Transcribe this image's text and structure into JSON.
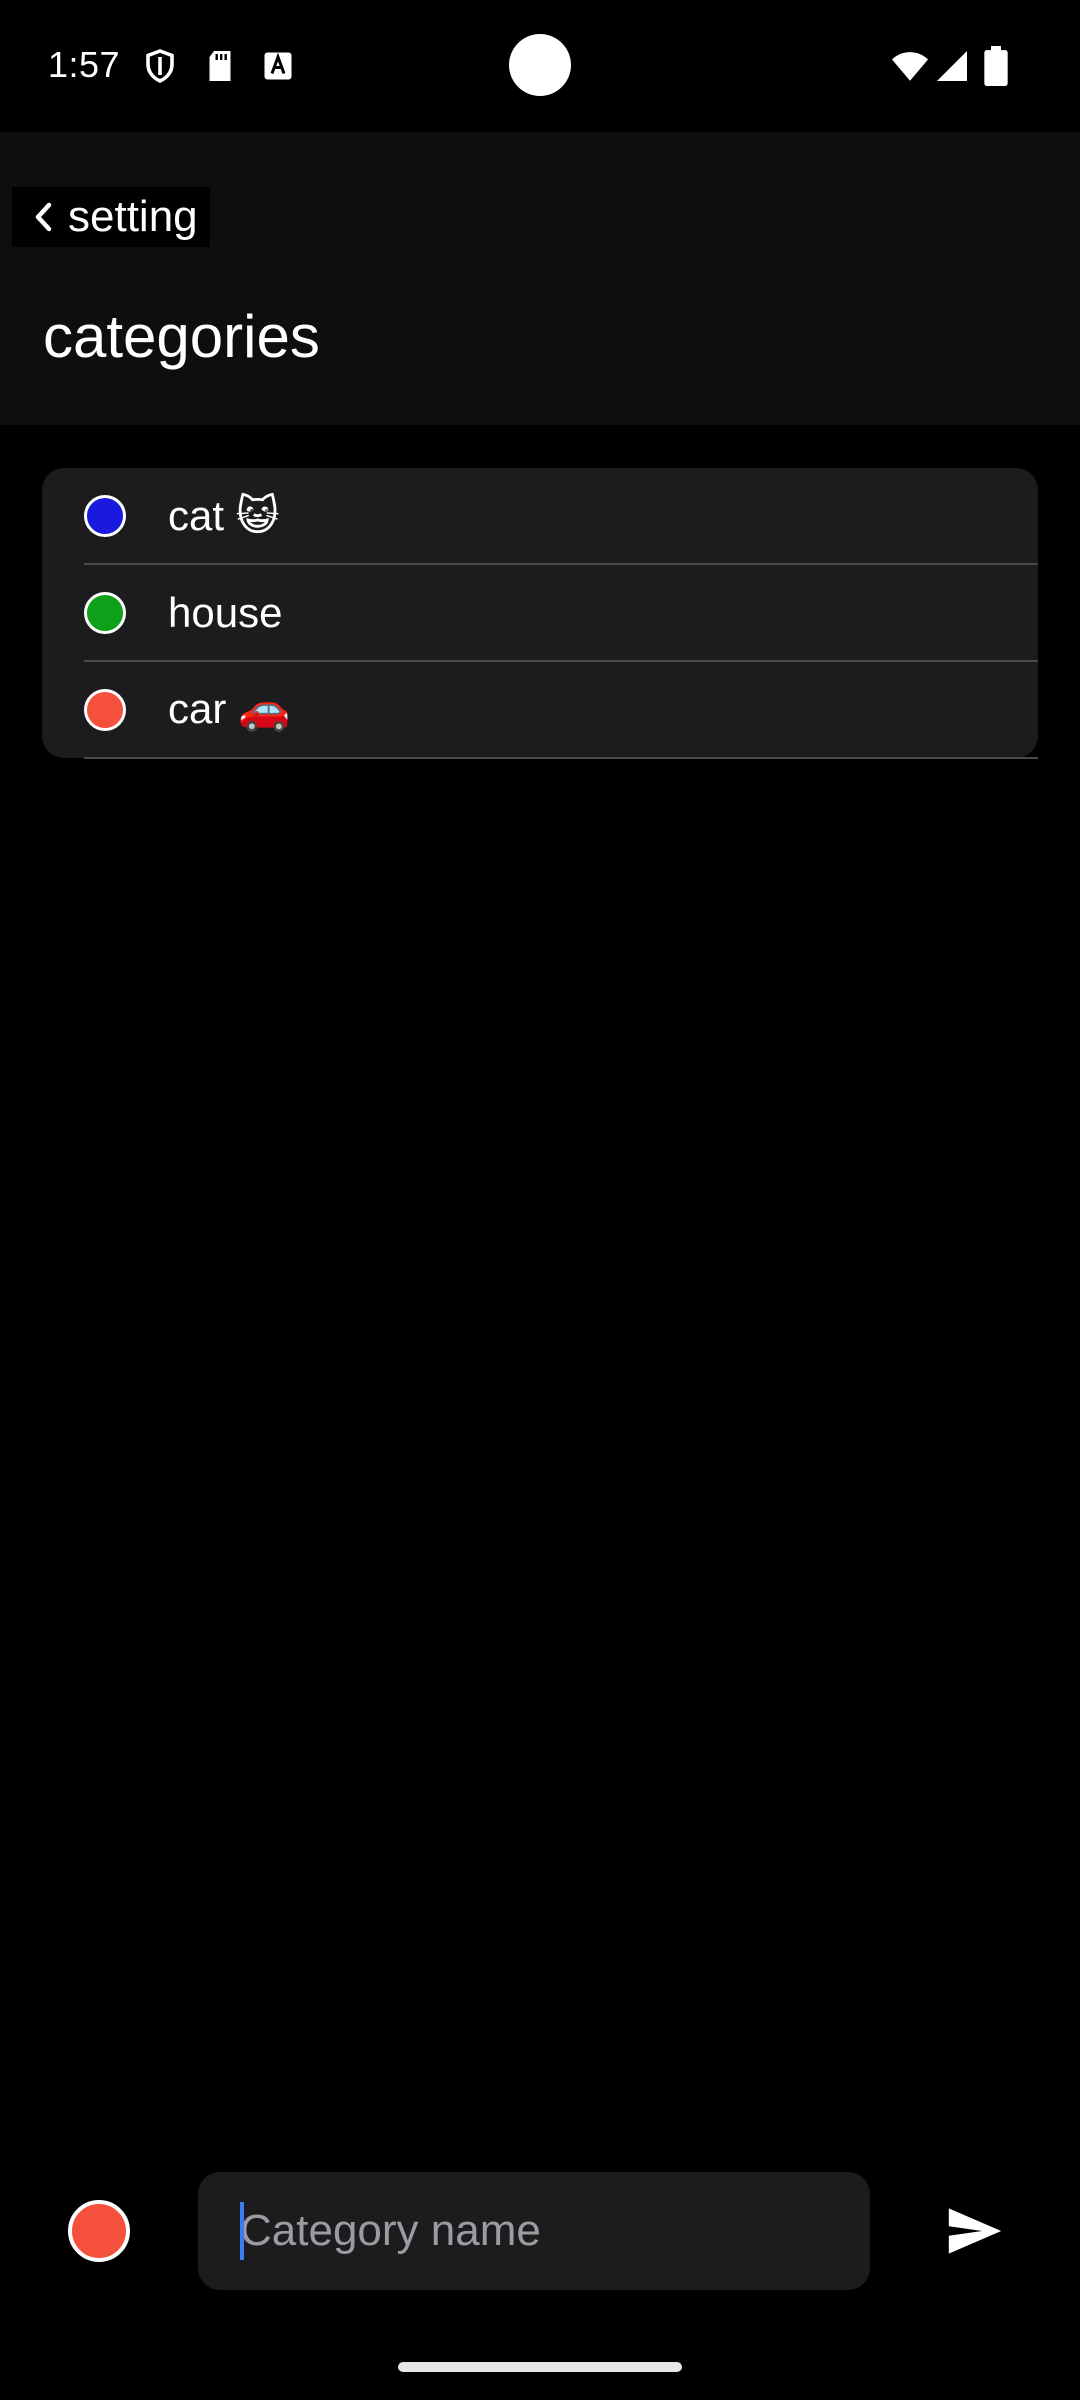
{
  "status_bar": {
    "time": "1:57",
    "left_icons": [
      "shield-icon",
      "sd-card-icon",
      "font-a-icon"
    ],
    "right_icons": [
      "wifi-icon",
      "signal-icon",
      "battery-icon"
    ]
  },
  "header": {
    "back_label": "setting",
    "back_icon": "chevron-left-icon",
    "title": "categories"
  },
  "categories": [
    {
      "name": "cat 😺",
      "color": "#1a1adf"
    },
    {
      "name": "house",
      "color": "#0fa01a"
    },
    {
      "name": "car 🚗",
      "color": "#f4503c"
    }
  ],
  "composer": {
    "selected_color": "#f4503c",
    "input_value": "",
    "placeholder": "Category name",
    "send_icon": "send-icon"
  },
  "colors": {
    "background": "#000000",
    "header_bg": "#0e0e0e",
    "card_bg": "#1c1c1e",
    "caret": "#3d7bf5"
  }
}
